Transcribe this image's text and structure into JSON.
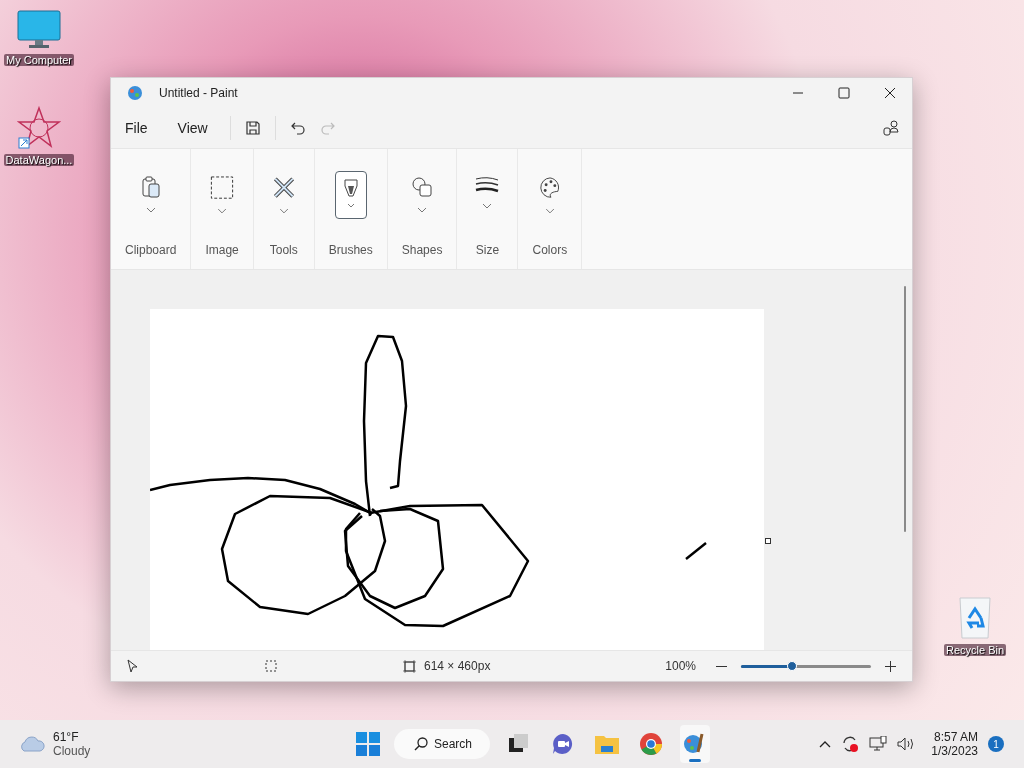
{
  "desktop_icons": [
    {
      "label": "My Computer",
      "kind": "monitor"
    },
    {
      "label": "DataWagon...",
      "kind": "shortcut"
    },
    {
      "label": "Recycle Bin",
      "kind": "recycle"
    }
  ],
  "window": {
    "title": "Untitled - Paint"
  },
  "menu": [
    {
      "label": "File"
    },
    {
      "label": "View"
    }
  ],
  "ribbon": [
    {
      "label": "Clipboard",
      "kind": "clipboard",
      "selected": false
    },
    {
      "label": "Image",
      "kind": "image",
      "selected": false
    },
    {
      "label": "Tools",
      "kind": "tools",
      "selected": false
    },
    {
      "label": "Brushes",
      "kind": "brushes",
      "selected": true
    },
    {
      "label": "Shapes",
      "kind": "shapes",
      "selected": false
    },
    {
      "label": "Size",
      "kind": "size",
      "selected": false
    },
    {
      "label": "Colors",
      "kind": "colors",
      "selected": false
    }
  ],
  "status_bar": {
    "dimensions": "614 × 460px",
    "zoom": "100%",
    "zoom_slider": {
      "level": 0.39
    }
  },
  "taskbar": {
    "weather": {
      "temperature": "61°F",
      "condition": "Cloudy"
    },
    "search": "Search",
    "apps": [
      {
        "kind": "taskview",
        "selected": false
      },
      {
        "kind": "chat",
        "selected": false
      },
      {
        "kind": "explorer",
        "selected": false
      },
      {
        "kind": "browser",
        "selected": false
      },
      {
        "kind": "paint",
        "selected": true
      }
    ],
    "time": "8:57 AM",
    "date": "1/3/2023",
    "notifications": "1"
  }
}
